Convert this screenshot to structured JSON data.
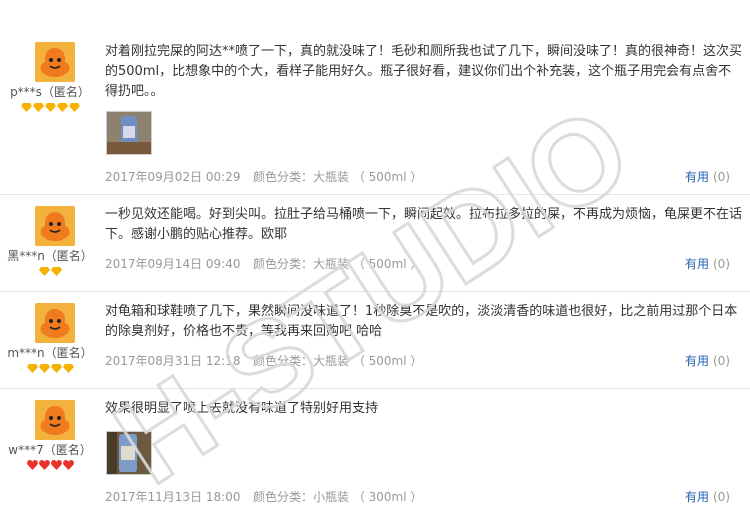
{
  "reviews": [
    {
      "username": "p***s（匿名）",
      "rank_icons": [
        "diamond-icon",
        "diamond-icon",
        "diamond-icon",
        "diamond-icon",
        "diamond-icon"
      ],
      "text": "对着刚拉完屎的阿达**喷了一下，真的就没味了！毛砂和厕所我也试了几下，瞬间没味了！真的很神奇！这次买的500ml，比想象中的个大，看样子能用好久。瓶子很好看，建议你们出个补充装，这个瓶子用完会有点舍不得扔吧。。",
      "has_photo": true,
      "date": "2017年09月02日 00:29",
      "spec": "颜色分类：大瓶装 （ 500ml ）",
      "useful_label": "有用",
      "useful_count": "(0)"
    },
    {
      "username": "黑***n（匿名）",
      "rank_icons": [
        "diamond-icon",
        "diamond-icon"
      ],
      "text": "一秒见效还能喝。好到尖叫。拉肚子给马桶喷一下，瞬间起效。拉布拉多拉的屎，不再成为烦恼，龟屎更不在话下。感谢小鹏的贴心推荐。欧耶",
      "has_photo": false,
      "date": "2017年09月14日 09:40",
      "spec": "颜色分类：大瓶装 （ 500ml ）",
      "useful_label": "有用",
      "useful_count": "(0)"
    },
    {
      "username": "m***n（匿名）",
      "rank_icons": [
        "diamond-icon",
        "diamond-icon",
        "diamond-icon",
        "diamond-icon"
      ],
      "text": "对龟箱和球鞋喷了几下，果然瞬间没味道了！1秒除臭不是吹的，淡淡清香的味道也很好，比之前用过那个日本的除臭剂好，价格也不贵，等我再来回购吧 哈哈",
      "has_photo": false,
      "date": "2017年08月31日 12:18",
      "spec": "颜色分类：大瓶装 （ 500ml ）",
      "useful_label": "有用",
      "useful_count": "(0)"
    },
    {
      "username": "w***7（匿名）",
      "rank_icons": [
        "heart-icon",
        "heart-icon",
        "heart-icon",
        "heart-icon"
      ],
      "text": "效果很明显了喷上去就没有味道了特别好用支持",
      "has_photo": true,
      "date": "2017年11月13日 18:00",
      "spec": "颜色分类：小瓶装 （ 300ml ）",
      "useful_label": "有用",
      "useful_count": "(0)"
    }
  ],
  "watermark": "H-STUDIO",
  "colors": {
    "link": "#2465b3",
    "meta": "#999999",
    "avatar": "#f3b23c",
    "diamond": "#f5b000",
    "heart": "#e8332c"
  }
}
